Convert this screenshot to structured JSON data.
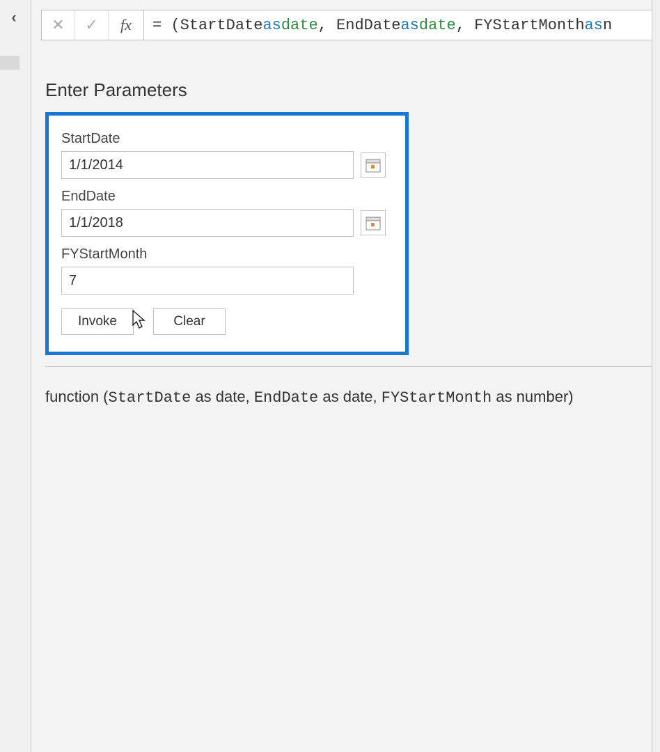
{
  "formula_bar": {
    "fx_symbol": "fx",
    "tokens": {
      "t1": "= (StartDate ",
      "t2": "as",
      "t3": " ",
      "t4": "date",
      "t5": ", EndDate ",
      "t6": "as",
      "t7": " ",
      "t8": "date",
      "t9": ", FYStartMonth ",
      "t10": "as",
      "t11": " n"
    }
  },
  "back_glyph": "‹",
  "cancel_glyph": "✕",
  "confirm_glyph": "✓",
  "parameters": {
    "title": "Enter Parameters",
    "start": {
      "label": "StartDate",
      "value": "1/1/2014"
    },
    "end": {
      "label": "EndDate",
      "value": "1/1/2018"
    },
    "fy": {
      "label": "FYStartMonth",
      "value": "7"
    },
    "buttons": {
      "invoke": "Invoke",
      "clear": "Clear"
    }
  },
  "signature": {
    "t1": "function (",
    "p1": "StartDate",
    "t2": " as date, ",
    "p2": "EndDate",
    "t3": " as date, ",
    "p3": "FYStartMonth",
    "t4": " as number) "
  }
}
